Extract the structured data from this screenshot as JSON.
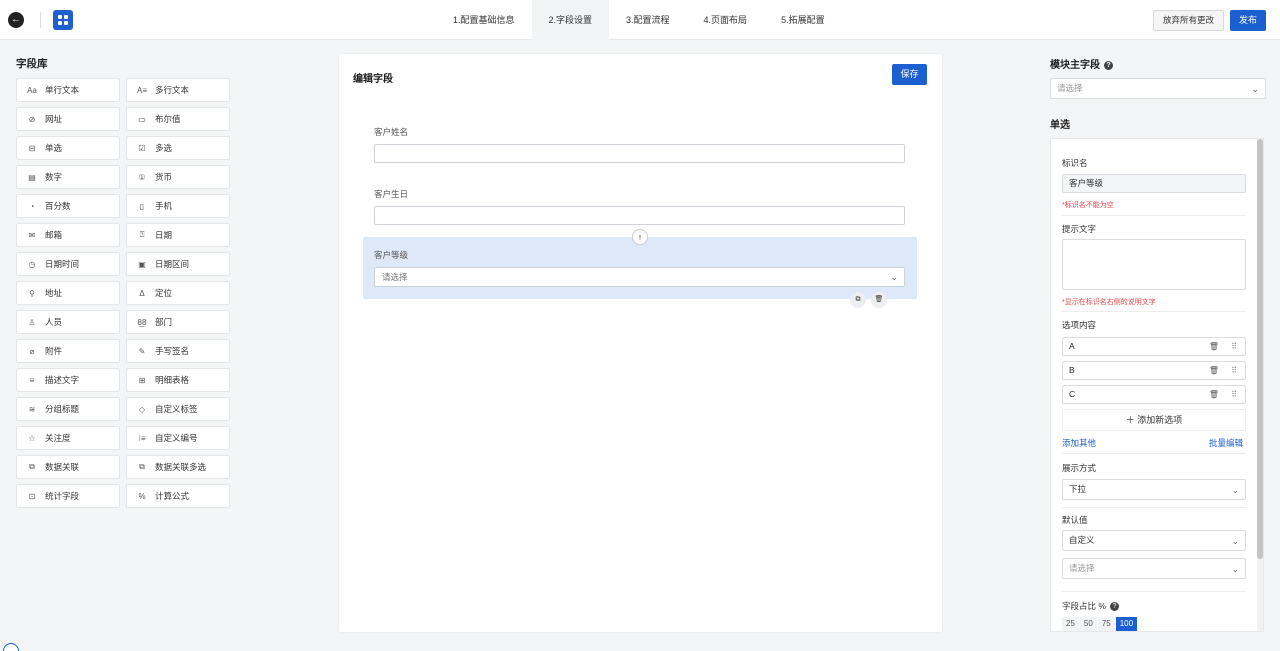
{
  "steps": [
    "1.配置基础信息",
    "2.字段设置",
    "3.配置流程",
    "4.页面布局",
    "5.拓展配置"
  ],
  "topbar": {
    "discard": "放弃所有更改",
    "publish": "发布"
  },
  "library": {
    "title": "字段库",
    "items": [
      {
        "icon": "Aa",
        "label": "单行文本"
      },
      {
        "icon": "A≡",
        "label": "多行文本"
      },
      {
        "icon": "⊘",
        "label": "网址"
      },
      {
        "icon": "▭",
        "label": "布尔值"
      },
      {
        "icon": "⊟",
        "label": "单选"
      },
      {
        "icon": "☑",
        "label": "多选"
      },
      {
        "icon": "▤",
        "label": "数字"
      },
      {
        "icon": "①",
        "label": "货币"
      },
      {
        "icon": "◔",
        "label": "百分数"
      },
      {
        "icon": "▯",
        "label": "手机"
      },
      {
        "icon": "✉",
        "label": "邮箱"
      },
      {
        "icon": "⍰",
        "label": "日期"
      },
      {
        "icon": "◷",
        "label": "日期时间"
      },
      {
        "icon": "▣",
        "label": "日期区间"
      },
      {
        "icon": "⚲",
        "label": "地址"
      },
      {
        "icon": "Δ",
        "label": "定位"
      },
      {
        "icon": "♙",
        "label": "人员"
      },
      {
        "icon": "8̲8",
        "label": "部门"
      },
      {
        "icon": "⌀",
        "label": "附件"
      },
      {
        "icon": "✎",
        "label": "手写签名"
      },
      {
        "icon": "≡",
        "label": "描述文字"
      },
      {
        "icon": "⊞",
        "label": "明细表格"
      },
      {
        "icon": "≋",
        "label": "分组标题"
      },
      {
        "icon": "◇",
        "label": "自定义标签"
      },
      {
        "icon": "☆",
        "label": "关注度"
      },
      {
        "icon": "⁝≡",
        "label": "自定义编号"
      },
      {
        "icon": "⧉",
        "label": "数据关联"
      },
      {
        "icon": "⧉",
        "label": "数据关联多选"
      },
      {
        "icon": "⊡",
        "label": "统计字段"
      },
      {
        "icon": "%",
        "label": "计算公式"
      }
    ]
  },
  "canvas": {
    "title": "编辑字段",
    "save": "保存",
    "fields": [
      {
        "label": "客户姓名"
      },
      {
        "label": "客户生日"
      },
      {
        "label": "客户等级",
        "placeholder": "请选择"
      }
    ]
  },
  "right": {
    "main_field_title": "模块主字段",
    "main_field_placeholder": "请选择",
    "section_title": "单选",
    "name_label": "标识名",
    "name_value": "客户等级",
    "name_hint": "*标识名不能为空",
    "tip_label": "提示文字",
    "tip_hint": "*显示在标识名右侧的说明文字",
    "options_label": "选项内容",
    "options": [
      "A",
      "B",
      "C"
    ],
    "add_option": "添加新选项",
    "add_other": "添加其他",
    "batch_edit": "批量编辑",
    "display_label": "展示方式",
    "display_value": "下拉",
    "default_label": "默认值",
    "default_value": "自定义",
    "default_placeholder": "请选择",
    "ratio_label": "字段占比 %",
    "ratios": [
      "25",
      "50",
      "75",
      "100"
    ]
  }
}
